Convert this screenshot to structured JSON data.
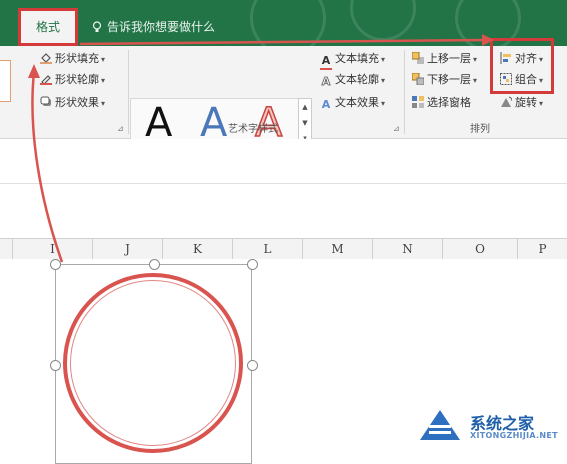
{
  "tabs": {
    "active": "格式"
  },
  "tell_me": {
    "text": "告诉我你想要做什么"
  },
  "shape_styles": {
    "fill": "形状填充",
    "outline": "形状轮廓",
    "effects": "形状效果"
  },
  "wordart": {
    "sample": "A",
    "text_fill": "文本填充",
    "text_outline": "文本轮廓",
    "text_effects": "文本效果",
    "group_label": "艺术字样式"
  },
  "arrange": {
    "bring_forward": "上移一层",
    "send_backward": "下移一层",
    "selection_pane": "选择窗格",
    "align": "对齐",
    "group": "组合",
    "rotate": "旋转",
    "group_label": "排列"
  },
  "columns": [
    "I",
    "J",
    "K",
    "L",
    "M",
    "N",
    "O",
    "P"
  ],
  "watermark": {
    "title": "系统之家",
    "url": "XITONGZHIJIA.NET"
  },
  "colors": {
    "ribbon_green": "#227447",
    "highlight_red": "#d33b3b",
    "circle_red": "#d9534f"
  }
}
